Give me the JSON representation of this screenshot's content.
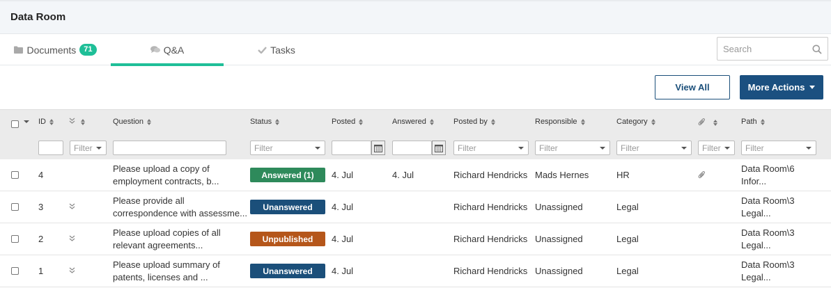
{
  "header": {
    "title": "Data Room"
  },
  "tabs": [
    {
      "label": "Documents",
      "badge": "71",
      "icon": "folder-icon"
    },
    {
      "label": "Q&A",
      "icon": "comments-icon"
    },
    {
      "label": "Tasks",
      "icon": "check-icon"
    }
  ],
  "search": {
    "placeholder": "Search",
    "value": ""
  },
  "actions": {
    "view_all": "View All",
    "more_actions": "More Actions"
  },
  "table": {
    "columns": {
      "id": "ID",
      "question": "Question",
      "status": "Status",
      "posted": "Posted",
      "answered": "Answered",
      "posted_by": "Posted by",
      "responsible": "Responsible",
      "category": "Category",
      "path": "Path"
    },
    "filter_label": "Filter",
    "rows": [
      {
        "id": "4",
        "question_line1": "Please upload a copy of",
        "question_line2": "employment contracts, b...",
        "status": "Answered (1)",
        "status_color": "#2e8a5b",
        "posted": "4. Jul",
        "answered": "4. Jul",
        "posted_by": "Richard Hendricks",
        "responsible": "Mads Hernes",
        "category": "HR",
        "has_attachment": true,
        "path_line1": "Data Room\\6",
        "path_line2": "Infor..."
      },
      {
        "id": "3",
        "question_line1": "Please provide all",
        "question_line2": "correspondence with assessme...",
        "status": "Unanswered",
        "status_color": "#1b4f7a",
        "posted": "4. Jul",
        "answered": "",
        "posted_by": "Richard Hendricks",
        "responsible": "Unassigned",
        "category": "Legal",
        "has_attachment": false,
        "path_line1": "Data Room\\3",
        "path_line2": "Legal..."
      },
      {
        "id": "2",
        "question_line1": "Please upload copies of all",
        "question_line2": "relevant agreements...",
        "status": "Unpublished",
        "status_color": "#b5561a",
        "posted": "4. Jul",
        "answered": "",
        "posted_by": "Richard Hendricks",
        "responsible": "Unassigned",
        "category": "Legal",
        "has_attachment": false,
        "path_line1": "Data Room\\3",
        "path_line2": "Legal..."
      },
      {
        "id": "1",
        "question_line1": "Please upload summary of",
        "question_line2": "patents, licenses and ...",
        "status": "Unanswered",
        "status_color": "#1b4f7a",
        "posted": "4. Jul",
        "answered": "",
        "posted_by": "Richard Hendricks",
        "responsible": "Unassigned",
        "category": "Legal",
        "has_attachment": false,
        "path_line1": "Data Room\\3",
        "path_line2": "Legal..."
      }
    ]
  }
}
